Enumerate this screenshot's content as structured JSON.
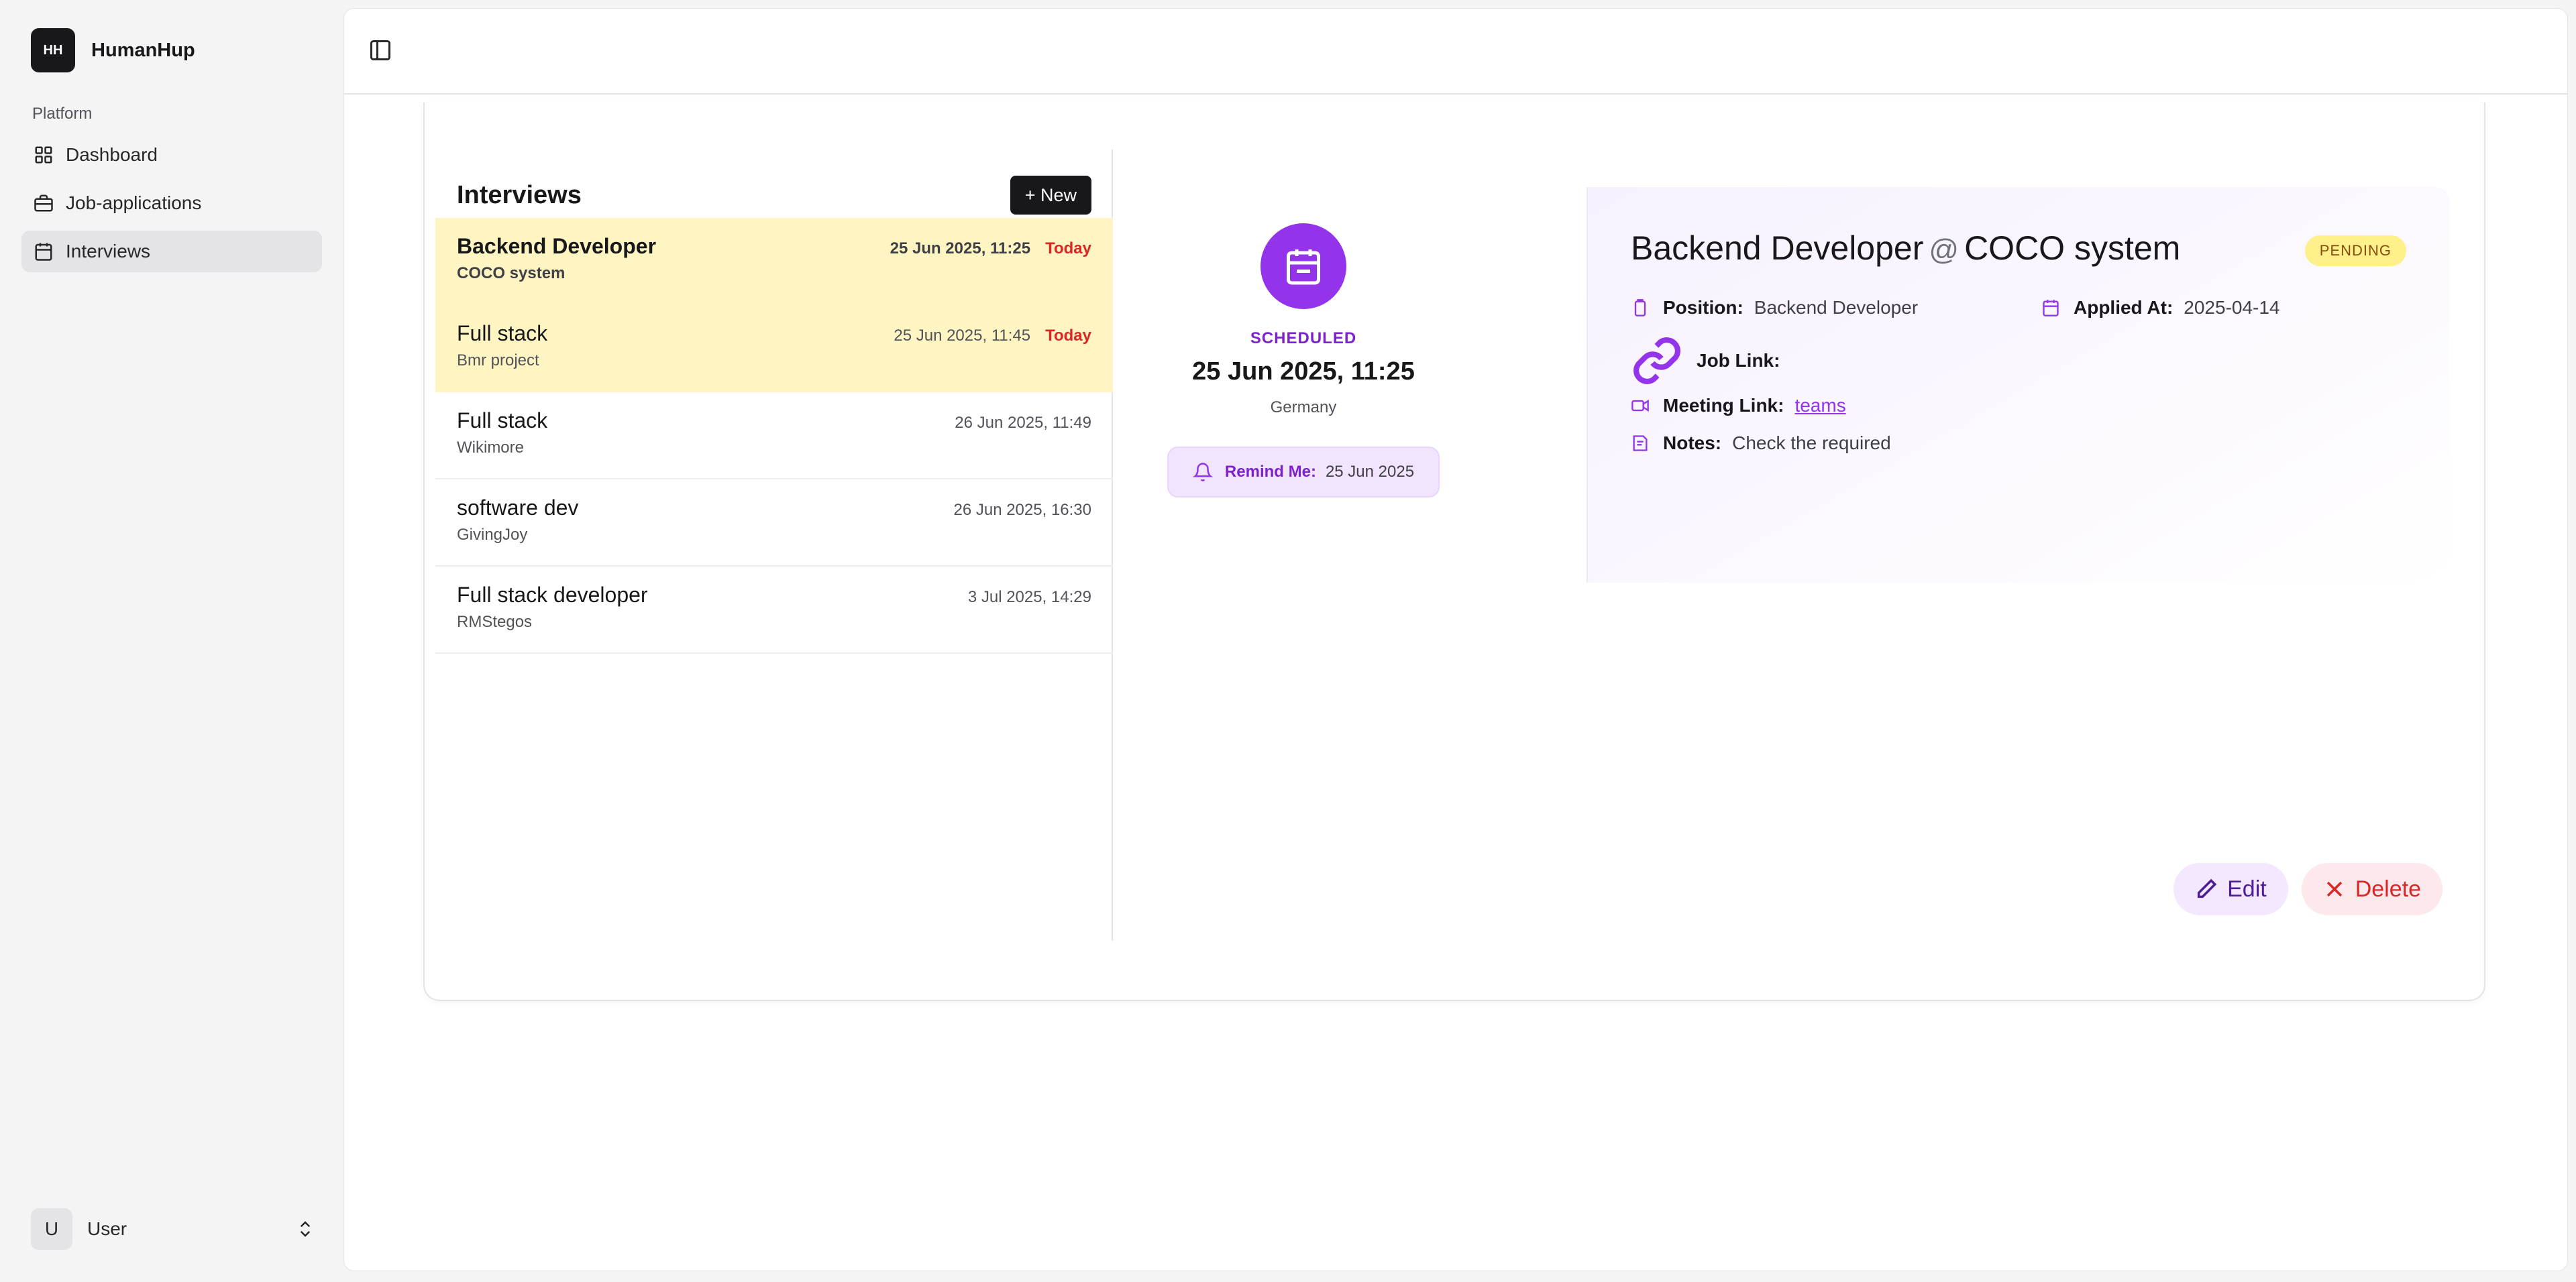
{
  "brand": {
    "logo_text": "HH",
    "name": "HumanHup"
  },
  "sidebar": {
    "group_label": "Platform",
    "items": [
      {
        "label": "Dashboard",
        "icon": "dashboard-icon"
      },
      {
        "label": "Job-applications",
        "icon": "briefcase-icon"
      },
      {
        "label": "Interviews",
        "icon": "calendar-icon",
        "active": true
      }
    ],
    "user": {
      "initial": "U",
      "name": "User"
    }
  },
  "interviews": {
    "title": "Interviews",
    "new_label": "+ New",
    "today_label": "Today",
    "rows": [
      {
        "title": "Backend Developer",
        "company": "COCO system",
        "date": "25 Jun 2025, 11:25",
        "today": true,
        "selected": true
      },
      {
        "title": "Full stack",
        "company": "Bmr project",
        "date": "25 Jun 2025, 11:45",
        "today": true
      },
      {
        "title": "Full stack",
        "company": "Wikimore",
        "date": "26 Jun 2025, 11:49"
      },
      {
        "title": "software dev",
        "company": "GivingJoy",
        "date": "26 Jun 2025, 16:30"
      },
      {
        "title": "Full stack developer",
        "company": "RMStegos",
        "date": "3 Jul 2025, 14:29"
      }
    ]
  },
  "detail": {
    "status": "SCHEDULED",
    "date": "25 Jun 2025, 11:25",
    "location": "Germany",
    "remind_label": "Remind Me:",
    "remind_value": "25 Jun 2025",
    "title_position": "Backend Developer",
    "title_at": "@",
    "title_company": "COCO system",
    "badge": "PENDING",
    "position_label": "Position:",
    "position_value": "Backend Developer",
    "applied_label": "Applied At:",
    "applied_value": "2025-04-14",
    "job_link_label": "Job Link:",
    "meeting_label": "Meeting Link:",
    "meeting_value": "teams",
    "notes_label": "Notes:",
    "notes_value": "Check the required",
    "edit_label": "Edit",
    "delete_label": "Delete"
  },
  "colors": {
    "accent": "#9333ea",
    "today_row": "#fef5c2",
    "today_text": "#dc2626",
    "badge_bg": "#fef08a"
  }
}
